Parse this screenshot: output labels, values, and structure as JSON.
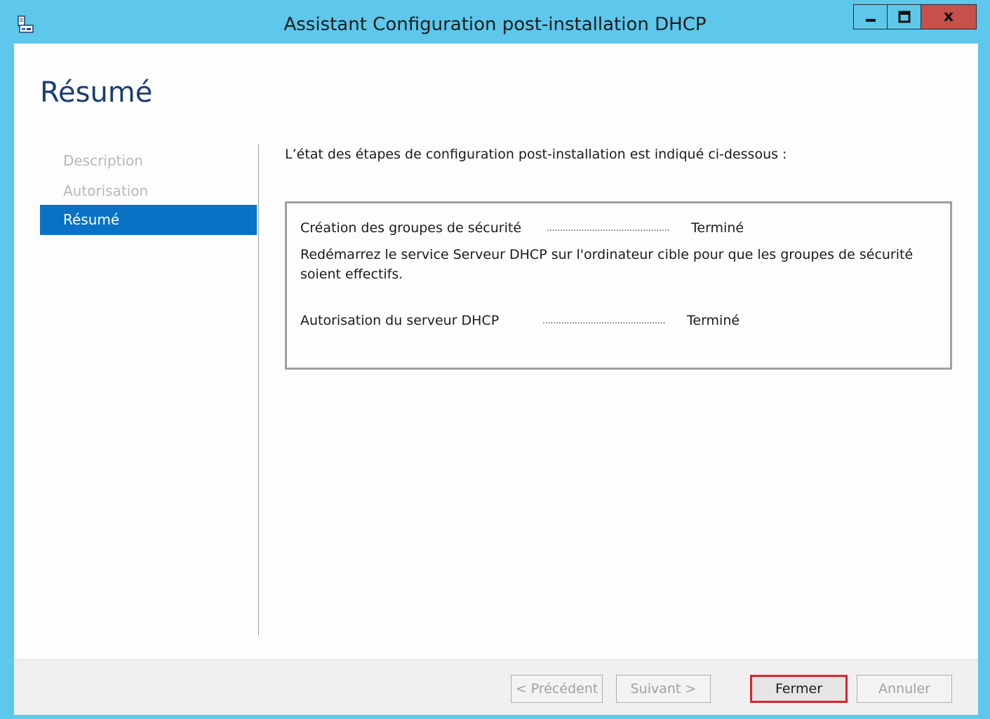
{
  "window": {
    "title": "Assistant Configuration post-installation DHCP",
    "accent_color": "#5dc7ec",
    "close_color": "#c7504a"
  },
  "caption_buttons": {
    "minimize_icon": "minimize-icon",
    "maximize_icon": "maximize-icon",
    "close_label": "x"
  },
  "page": {
    "title": "Résumé"
  },
  "nav": {
    "items": [
      {
        "label": "Description",
        "active": false
      },
      {
        "label": "Autorisation",
        "active": false
      },
      {
        "label": "Résumé",
        "active": true
      }
    ],
    "active_color": "#0a72c5"
  },
  "main": {
    "intro": "L’état des étapes de configuration post-installation est indiqué ci-dessous :",
    "steps": [
      {
        "label": "Création des groupes de sécurité",
        "dots": "..............................................",
        "status": "Terminé"
      },
      {
        "label": "Autorisation du serveur DHCP",
        "dots": "..............................................",
        "status": "Terminé"
      }
    ],
    "note": "Redémarrez le service Serveur DHCP sur l'ordinateur cible pour que les groupes de sécurité soient effectifs."
  },
  "footer": {
    "previous_label": "< Précédent",
    "next_label": "Suivant >",
    "close_label": "Fermer",
    "cancel_label": "Annuler",
    "highlight_color": "#e0212b"
  }
}
